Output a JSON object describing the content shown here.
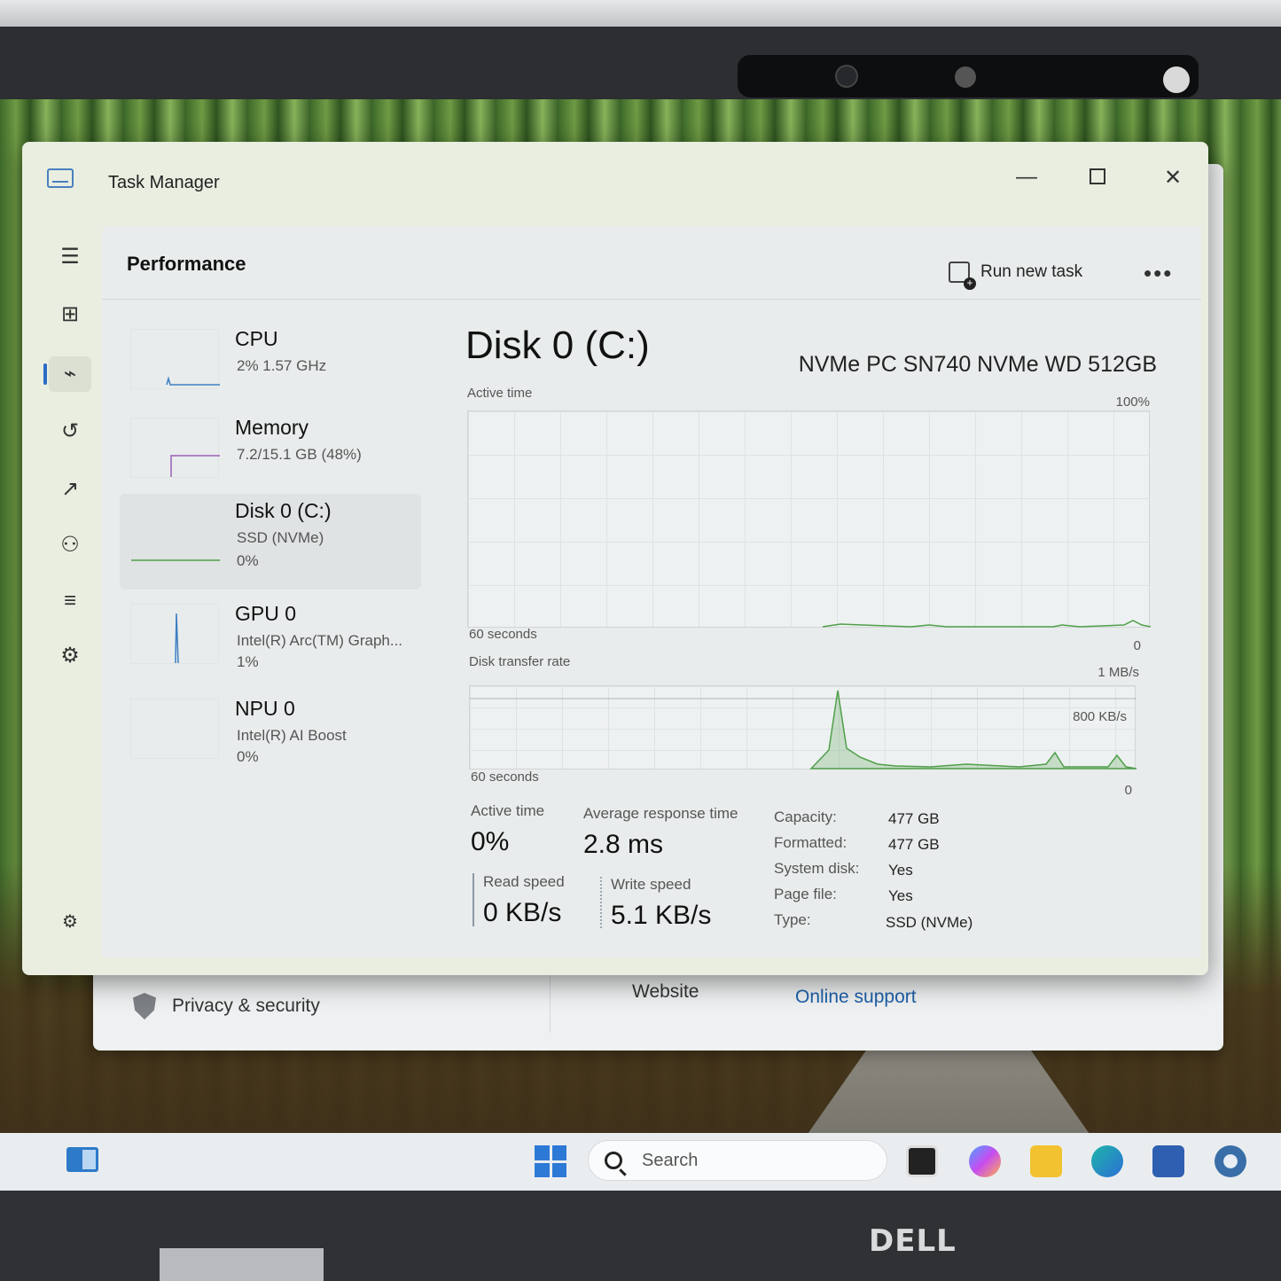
{
  "task_manager": {
    "title": "Task Manager",
    "page_title": "Performance",
    "run_new_task": "Run new task",
    "more": "•••"
  },
  "nav_icons": [
    "hamburger-menu-icon",
    "processes-icon",
    "performance-icon",
    "app-history-icon",
    "startup-apps-icon",
    "users-icon",
    "details-icon",
    "services-icon",
    "settings-icon"
  ],
  "devices": [
    {
      "name": "CPU",
      "line1": "2%  1.57 GHz",
      "line2": ""
    },
    {
      "name": "Memory",
      "line1": "7.2/15.1 GB (48%)",
      "line2": ""
    },
    {
      "name": "Disk 0 (C:)",
      "line1": "SSD (NVMe)",
      "line2": "0%"
    },
    {
      "name": "GPU 0",
      "line1": "Intel(R) Arc(TM) Graph...",
      "line2": "1%"
    },
    {
      "name": "NPU 0",
      "line1": "Intel(R) AI Boost",
      "line2": "0%"
    }
  ],
  "detail": {
    "title": "Disk 0 (C:)",
    "model": "NVMe PC SN740 NVMe WD 512GB",
    "graph1": {
      "label": "Active time",
      "max": "100%",
      "duration": "60 seconds",
      "min": "0"
    },
    "graph2": {
      "label": "Disk transfer rate",
      "max": "1 MB/s",
      "mid": "800 KB/s",
      "duration": "60 seconds",
      "min": "0"
    },
    "stats": {
      "active_time_label": "Active time",
      "active_time": "0%",
      "avg_response_label": "Average response time",
      "avg_response": "2.8 ms",
      "read_label": "Read speed",
      "read": "0 KB/s",
      "write_label": "Write speed",
      "write": "5.1 KB/s"
    },
    "properties": [
      {
        "label": "Capacity:",
        "value": "477 GB"
      },
      {
        "label": "Formatted:",
        "value": "477 GB"
      },
      {
        "label": "System disk:",
        "value": "Yes"
      },
      {
        "label": "Page file:",
        "value": "Yes"
      },
      {
        "label": "Type:",
        "value": "SSD (NVMe)"
      }
    ]
  },
  "settings_bg": {
    "privacy": "Privacy & security",
    "website": "Website",
    "support": "Online support"
  },
  "taskbar": {
    "search_placeholder": "Search"
  },
  "brand": "DELL"
}
